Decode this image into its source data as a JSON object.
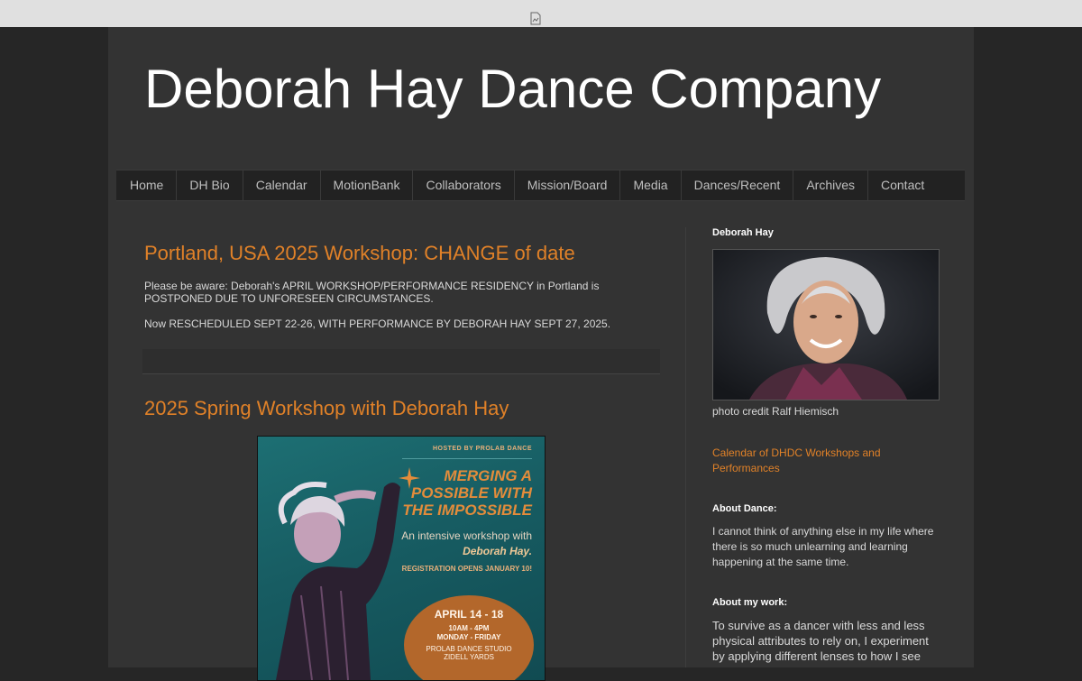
{
  "site": {
    "title": "Deborah Hay Dance Company"
  },
  "nav": [
    {
      "label": "Home"
    },
    {
      "label": "DH Bio"
    },
    {
      "label": "Calendar"
    },
    {
      "label": "MotionBank"
    },
    {
      "label": "Collaborators"
    },
    {
      "label": "Mission/Board"
    },
    {
      "label": "Media"
    },
    {
      "label": "Dances/Recent"
    },
    {
      "label": "Archives"
    },
    {
      "label": "Contact"
    }
  ],
  "posts": [
    {
      "title": "Portland, USA 2025 Workshop: CHANGE of date",
      "p1": "Please be aware: Deborah's APRIL WORKSHOP/PERFORMANCE RESIDENCY in Portland is POSTPONED DUE TO UNFORESEEN CIRCUMSTANCES.",
      "p2": "Now RESCHEDULED  SEPT 22-26, WITH PERFORMANCE BY DEBORAH HAY SEPT 27, 2025."
    },
    {
      "title": "2025 Spring Workshop with Deborah Hay"
    }
  ],
  "poster": {
    "hosted": "HOSTED BY PROLAB DANCE",
    "headline": "MERGING A POSSIBLE WITH THE IMPOSSIBLE",
    "sub_prefix": "An intensive workshop with",
    "sub_name": "Deborah Hay.",
    "registration": "REGISTRATION OPENS JANUARY 10!",
    "dates": "APRIL 14 - 18",
    "hours": "10AM - 4PM",
    "days": "MONDAY - FRIDAY",
    "studio": "PROLAB DANCE STUDIO",
    "venue": "ZIDELL YARDS"
  },
  "sidebar": {
    "heading": "Deborah Hay",
    "photo_credit": "photo credit Ralf Hiemisch",
    "calendar_link": "Calendar of DHDC Workshops and Performances",
    "about_dance_heading": "About Dance:",
    "about_dance_text": "I cannot think of anything else in my life where there is so much unlearning and learning happening at the same time.",
    "about_work_heading": "About my work:",
    "about_work_text": "To survive as a dancer with less and less physical attributes to rely on, I experiment by applying different lenses to how I see"
  },
  "colors": {
    "accent": "#e08128",
    "background": "#333333",
    "outer": "#262626"
  }
}
